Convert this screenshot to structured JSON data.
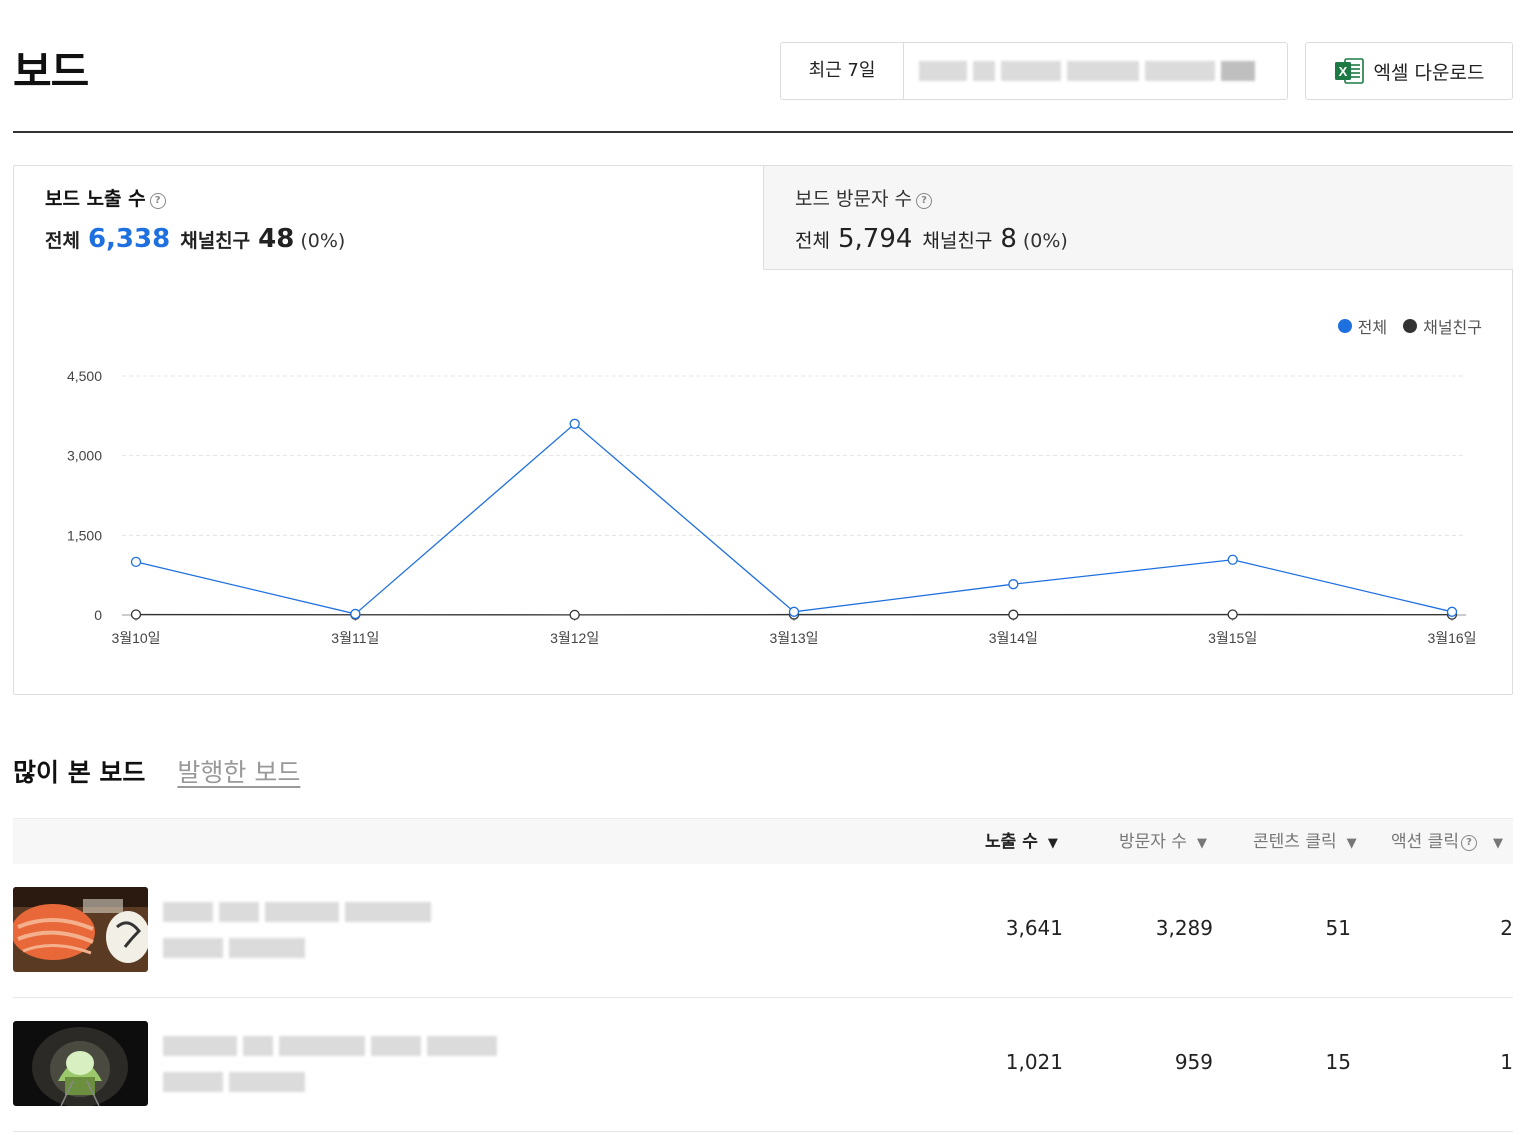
{
  "header": {
    "title": "보드",
    "period_label": "최근 7일",
    "excel_label": "엑셀 다운로드"
  },
  "stats": {
    "impressions": {
      "title": "보드 노출 수",
      "total_label": "전체",
      "total": "6,338",
      "friend_label": "채널친구",
      "friend": "48",
      "friend_pct": "(0%)"
    },
    "visitors": {
      "title": "보드 방문자 수",
      "total_label": "전체",
      "total": "5,794",
      "friend_label": "채널친구",
      "friend": "8",
      "friend_pct": "(0%)"
    }
  },
  "chart_data": {
    "type": "line",
    "categories": [
      "3월10일",
      "3월11일",
      "3월12일",
      "3월13일",
      "3월14일",
      "3월15일",
      "3월16일"
    ],
    "series": [
      {
        "name": "전체",
        "color": "#1e6fe0",
        "values": [
          1000,
          20,
          3600,
          60,
          580,
          1040,
          60
        ]
      },
      {
        "name": "채널친구",
        "color": "#333333",
        "values": [
          10,
          5,
          3,
          8,
          6,
          9,
          7
        ]
      }
    ],
    "yticks": [
      "4,500",
      "3,000",
      "1,500",
      "0"
    ],
    "ylim": [
      0,
      4500
    ],
    "grid": true,
    "legend_position": "top-right"
  },
  "tabs": [
    {
      "label": "많이 본 보드",
      "active": true
    },
    {
      "label": "발행한 보드",
      "active": false
    }
  ],
  "table": {
    "columns": [
      {
        "label": "노출 수",
        "active": true
      },
      {
        "label": "방문자 수",
        "active": false
      },
      {
        "label": "콘텐츠 클릭",
        "active": false
      },
      {
        "label": "액션 클릭",
        "active": false
      }
    ],
    "rows": [
      {
        "thumbnail": "food-photo",
        "impressions": "3,641",
        "visitors": "3,289",
        "content_clicks": "51",
        "action_clicks": "2"
      },
      {
        "thumbnail": "tunnel-photo",
        "impressions": "1,021",
        "visitors": "959",
        "content_clicks": "15",
        "action_clicks": "1"
      }
    ]
  }
}
